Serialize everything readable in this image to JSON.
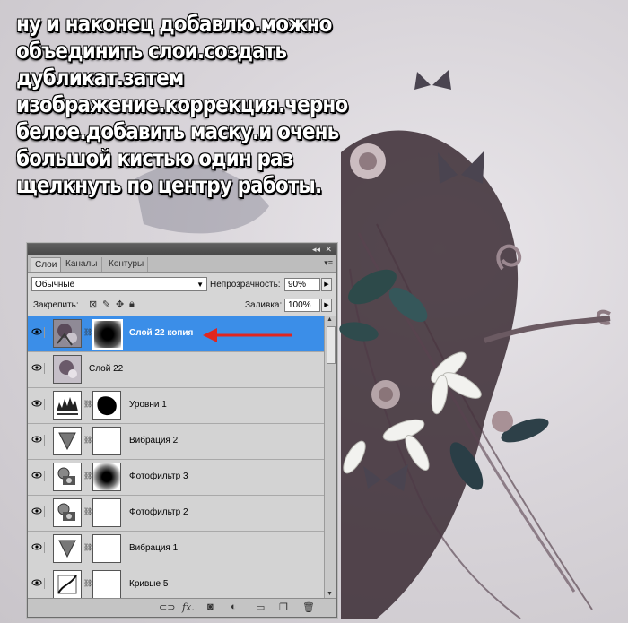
{
  "caption": {
    "lines": [
      "ну и наконец добавлю.можно",
      "объединить слои.создать",
      "дубликат.затем",
      "изображение.коррекция.черно",
      "белое.добавить маску.и очень",
      "большой кистью один раз",
      "щелкнуть по центру работы."
    ]
  },
  "panel": {
    "tabs": [
      "Слои",
      "Каналы",
      "Контуры"
    ],
    "active_tab": "Слои",
    "blend_mode": "Обычные",
    "opacity_label": "Непрозрачность:",
    "opacity_value": "90%",
    "lock_label": "Закрепить:",
    "fill_label": "Заливка:",
    "fill_value": "100%",
    "layers": [
      {
        "name": "Слой 22 копия",
        "selected": true,
        "thumb": "image",
        "mask": "radial-black"
      },
      {
        "name": "Слой 22",
        "selected": false,
        "thumb": "image",
        "mask": null
      },
      {
        "name": "Уровни 1",
        "selected": false,
        "thumb": "levels-icon",
        "mask": "blob-black"
      },
      {
        "name": "Вибрация 2",
        "selected": false,
        "thumb": "vibrance-icon",
        "mask": "white"
      },
      {
        "name": "Фотофильтр 3",
        "selected": false,
        "thumb": "photofilter-icon",
        "mask": "radial-black"
      },
      {
        "name": "Фотофильтр 2",
        "selected": false,
        "thumb": "photofilter-icon",
        "mask": "white"
      },
      {
        "name": "Вибрация 1",
        "selected": false,
        "thumb": "vibrance-icon",
        "mask": "white"
      },
      {
        "name": "Кривые 5",
        "selected": false,
        "thumb": "curves-icon",
        "mask": "white"
      }
    ],
    "bottom_icons": [
      "link-icon",
      "fx-icon",
      "mask-icon",
      "adjustment-icon",
      "group-folder-icon",
      "new-layer-icon",
      "trash-icon"
    ]
  },
  "colors": {
    "selected_row": "#3b8ee8",
    "arrow": "#e0261f"
  }
}
